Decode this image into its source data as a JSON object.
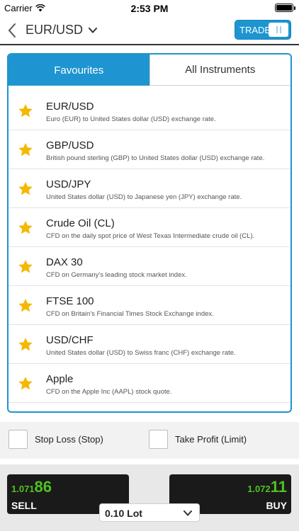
{
  "status_bar": {
    "carrier": "Carrier",
    "time": "2:53 PM"
  },
  "header": {
    "title": "EUR/USD",
    "trade_label": "TRADE"
  },
  "tabs": [
    {
      "label": "Favourites",
      "active": true
    },
    {
      "label": "All Instruments",
      "active": false
    }
  ],
  "instruments": [
    {
      "name": "EUR/USD",
      "desc": "Euro (EUR) to United States dollar (USD) exchange rate."
    },
    {
      "name": "GBP/USD",
      "desc": "British pound sterling (GBP) to United States dollar (USD) exchange rate."
    },
    {
      "name": "USD/JPY",
      "desc": "United States dollar (USD) to Japanese yen (JPY) exchange rate."
    },
    {
      "name": "Crude Oil (CL)",
      "desc": "CFD on the daily spot price of West Texas Intermediate crude oil (CL)."
    },
    {
      "name": "DAX 30",
      "desc": "CFD on Germany's leading stock market index."
    },
    {
      "name": "FTSE 100",
      "desc": "CFD on Britain's Financial Times Stock Exchange index."
    },
    {
      "name": "USD/CHF",
      "desc": "United States dollar (USD) to Swiss franc (CHF) exchange rate."
    },
    {
      "name": "Apple",
      "desc": "CFD on the Apple Inc (AAPL) stock quote."
    }
  ],
  "options": {
    "stop_loss": "Stop Loss (Stop)",
    "take_profit": "Take Profit (Limit)"
  },
  "trade": {
    "sell": {
      "price_prefix": "1.071",
      "price_main": "86",
      "label": "SELL"
    },
    "buy": {
      "price_prefix": "1.072",
      "price_main": "11",
      "label": "BUY"
    },
    "lot": "0.10 Lot"
  },
  "colors": {
    "accent": "#1e95d0",
    "star": "#f5b800",
    "price": "#4fc21f",
    "quote_bg": "#1a1a1a"
  },
  "icons": {
    "back": "chevron-left-icon",
    "dropdown": "chevron-down-icon",
    "favourite": "star-icon"
  }
}
